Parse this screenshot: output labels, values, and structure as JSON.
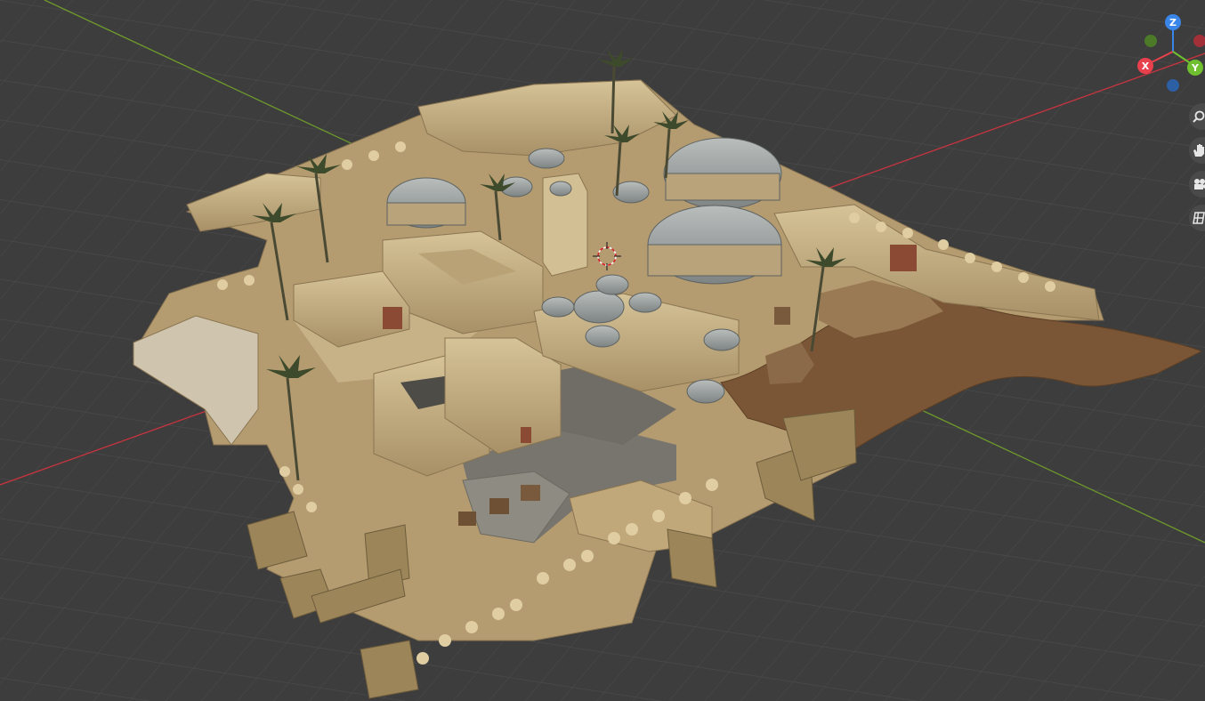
{
  "viewport": {
    "background": "#3d3d3d",
    "grid_color": "#4b4b4b",
    "x_axis_color": "#c8343f",
    "y_axis_color": "#6e9a2b"
  },
  "gizmo": {
    "x_label": "X",
    "y_label": "Y",
    "z_label": "Z",
    "x_color": "#e8414d",
    "y_color": "#6fbf2f",
    "z_color": "#3a86e8"
  },
  "nav_buttons": [
    {
      "icon": "zoom-icon"
    },
    {
      "icon": "hand-pan-icon"
    },
    {
      "icon": "camera-icon"
    },
    {
      "icon": "grid-ortho-icon"
    }
  ],
  "scene": {
    "object": "desert-town-model",
    "stone_color": "#c9b48a",
    "dome_color": "#9aa0a0",
    "terrain_color": "#7a5636",
    "palm_color": "#3e4a2c"
  }
}
